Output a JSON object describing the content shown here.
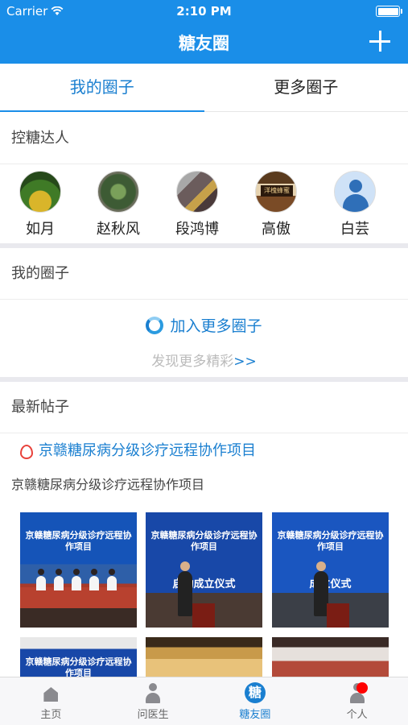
{
  "status_bar": {
    "carrier": "Carrier",
    "time": "2:10 PM"
  },
  "nav": {
    "title": "糖友圈",
    "add_icon": "plus-icon"
  },
  "tabs": [
    {
      "label": "我的圈子",
      "active": true
    },
    {
      "label": "更多圈子",
      "active": false
    }
  ],
  "experts_section": {
    "title": "控糖达人",
    "people": [
      {
        "name": "如月"
      },
      {
        "name": "赵秋风"
      },
      {
        "name": "段鸿博"
      },
      {
        "name": "高傲",
        "avatar_text": "洋槐蜂蜜"
      },
      {
        "name": "白芸"
      }
    ]
  },
  "my_circles": {
    "title": "我的圈子",
    "join_label": "加入更多圈子",
    "discover_label": "发现更多精彩",
    "discover_arrows": ">>"
  },
  "latest_posts": {
    "title": "最新帖子",
    "post_title": "京赣糖尿病分级诊疗远程协作项目",
    "post_body": "京赣糖尿病分级诊疗远程协作项目",
    "photo_banner": "京赣糖尿病分级诊疗远程协作项目",
    "photo_caption_2": "启动成立仪式",
    "photo_caption_3": "成立仪式"
  },
  "bottom_nav": [
    {
      "label": "主页",
      "icon": "home-icon"
    },
    {
      "label": "问医生",
      "icon": "doctor-icon"
    },
    {
      "label": "糖友圈",
      "icon": "sugar-circle-icon",
      "active": true,
      "glyph": "糖"
    },
    {
      "label": "个人",
      "icon": "person-icon",
      "badge": true
    }
  ],
  "colors": {
    "accent": "#1a8ee8",
    "link": "#1a7fd0",
    "badge": "#ff0000",
    "hot": "#e8413a"
  }
}
